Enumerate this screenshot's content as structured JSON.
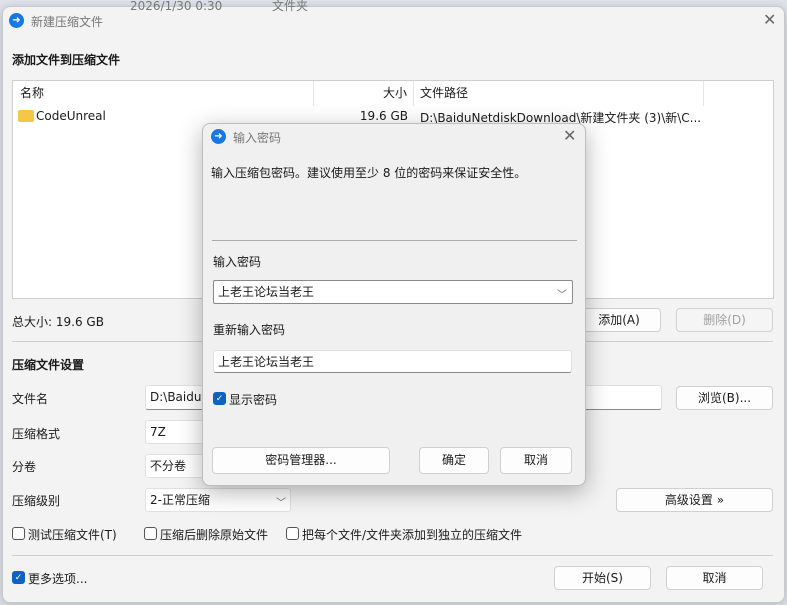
{
  "background": {
    "date": "2026/1/30 0:30",
    "type": "文件夹"
  },
  "main": {
    "title": "新建压缩文件",
    "add_section": "添加文件到压缩文件",
    "columns": [
      "名称",
      "大小",
      "文件路径"
    ],
    "files": [
      {
        "name": "CodeUnreal",
        "size": "19.6 GB",
        "path": "D:\\BaiduNetdiskDownload\\新建文件夹 (3)\\新\\C..."
      }
    ],
    "total": "总大小: 19.6 GB",
    "add_btn": "添加(A)",
    "delete_btn": "删除(D)",
    "settings_section": "压缩文件设置",
    "filename_label": "文件名",
    "filename_value": "D:\\BaiduN",
    "browse_btn": "浏览(B)...",
    "format_label": "压缩格式",
    "format_value": "7Z",
    "volume_label": "分卷",
    "volume_value": "不分卷",
    "level_label": "压缩级别",
    "level_value": "2-正常压缩",
    "advanced_btn": "高级设置 »",
    "test_cb": "测试压缩文件(T)",
    "delete_cb": "压缩后删除原始文件",
    "separate_cb": "把每个文件/文件夹添加到独立的压缩文件",
    "more_cb": "更多选项...",
    "start_btn": "开始(S)",
    "cancel_btn": "取消"
  },
  "dialog": {
    "title": "输入密码",
    "hint": "输入压缩包密码。建议使用至少 8 位的密码来保证安全性。",
    "pw_label": "输入密码",
    "pw_value": "上老王论坛当老王",
    "repw_label": "重新输入密码",
    "repw_value": "上老王论坛当老王",
    "show_cb": "显示密码",
    "manager_btn": "密码管理器...",
    "ok_btn": "确定",
    "cancel_btn": "取消"
  }
}
